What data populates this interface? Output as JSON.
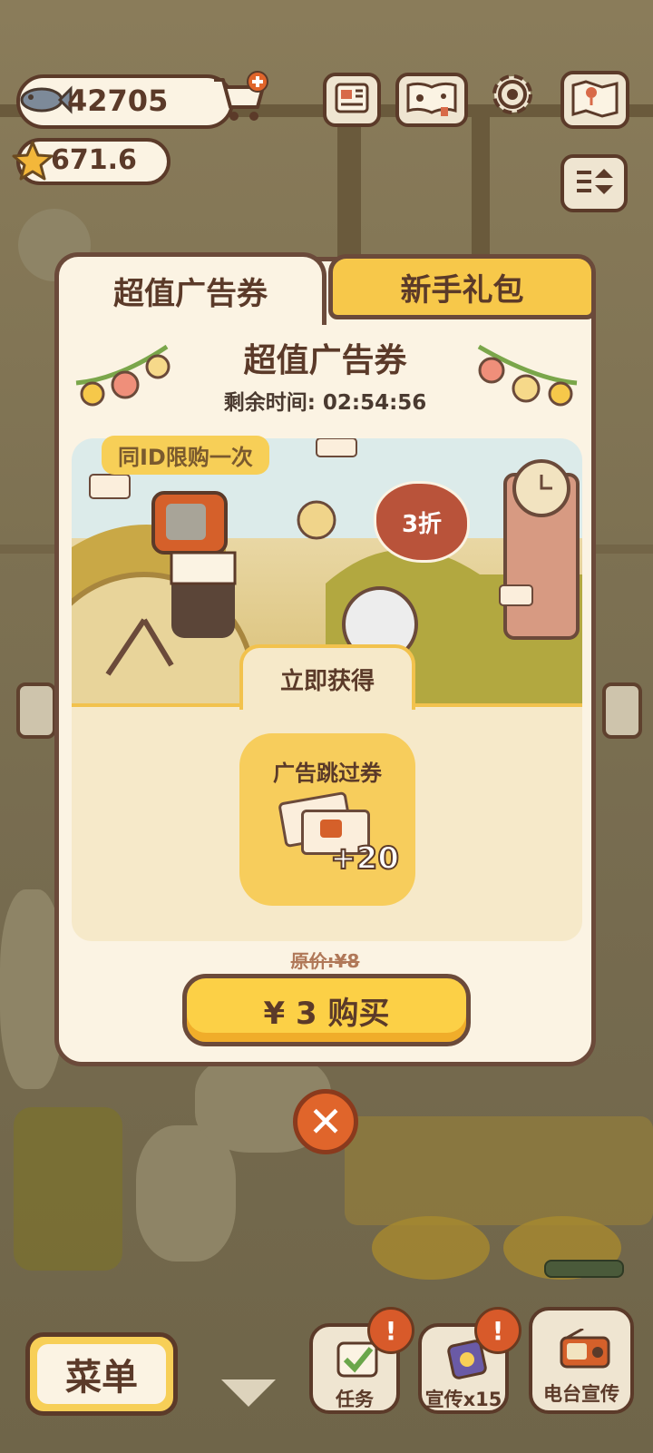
{
  "hud": {
    "fish_count": "42705",
    "star_count": "671.6",
    "icons": [
      "fish-icon",
      "cart-add-icon",
      "star-icon",
      "newspaper-icon",
      "paw-book-icon",
      "gear-icon",
      "map-icon",
      "sort-toggle-icon"
    ]
  },
  "dialog": {
    "tabs": [
      {
        "label": "超值广告券",
        "active": true
      },
      {
        "label": "新手礼包",
        "active": false
      }
    ],
    "title": "超值广告券",
    "countdown": "剩余时间: 02:54:56",
    "limit_tag": "同ID限购一次",
    "discount_badge": "3折",
    "get_now_label": "立即获得",
    "item": {
      "name": "广告跳过券",
      "quantity": "+20",
      "icon": "ad-skip-ticket-icon"
    },
    "original_price": "原价:¥8",
    "buy_button": "¥ 3 购买",
    "close_icon": "close-icon"
  },
  "bottom_bar": {
    "menu_label": "菜单",
    "task_label": "任务",
    "promote_label": "宣传x15",
    "radio_label": "电台宣传",
    "badge_text": "!"
  },
  "colors": {
    "accent_yellow": "#fcd046",
    "brown_outline": "#6b4a3a",
    "cream": "#fbf3e3",
    "close_orange": "#e0652b"
  }
}
